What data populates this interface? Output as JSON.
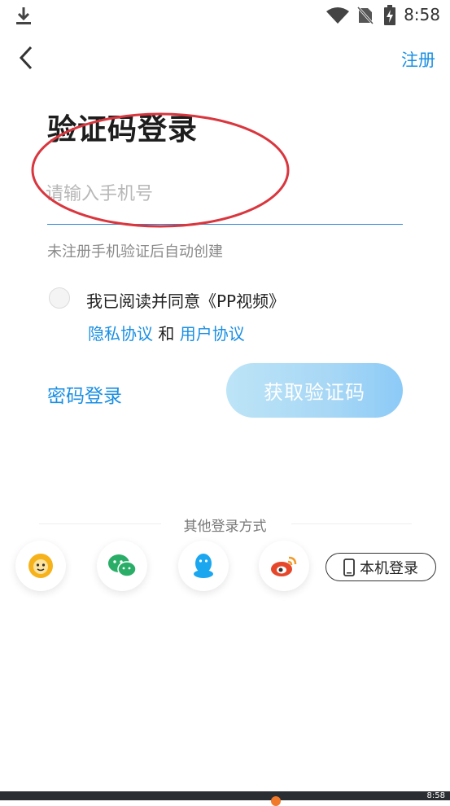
{
  "status_bar": {
    "time": "8:58"
  },
  "nav": {
    "register_label": "注册"
  },
  "title": "验证码登录",
  "phone_input": {
    "placeholder": "请输入手机号",
    "value": ""
  },
  "hint": "未注册手机验证后自动创建",
  "agreement": {
    "text": "我已阅读并同意《PP视频》",
    "privacy_label": "隐私协议",
    "and_label": "和",
    "user_label": "用户协议"
  },
  "password_login_label": "密码登录",
  "get_code_label": "获取验证码",
  "other_login": {
    "label": "其他登录方式",
    "icons": [
      "suning-lion-icon",
      "wechat-icon",
      "qq-icon",
      "weibo-icon"
    ],
    "local_login_label": "本机登录"
  },
  "bottom_bar": {
    "time": "8:58"
  },
  "colors": {
    "accent": "#1a8fe3",
    "annotation": "#d9363e",
    "button_gradient_start": "#bde4f7",
    "button_gradient_end": "#8ccaf7"
  }
}
